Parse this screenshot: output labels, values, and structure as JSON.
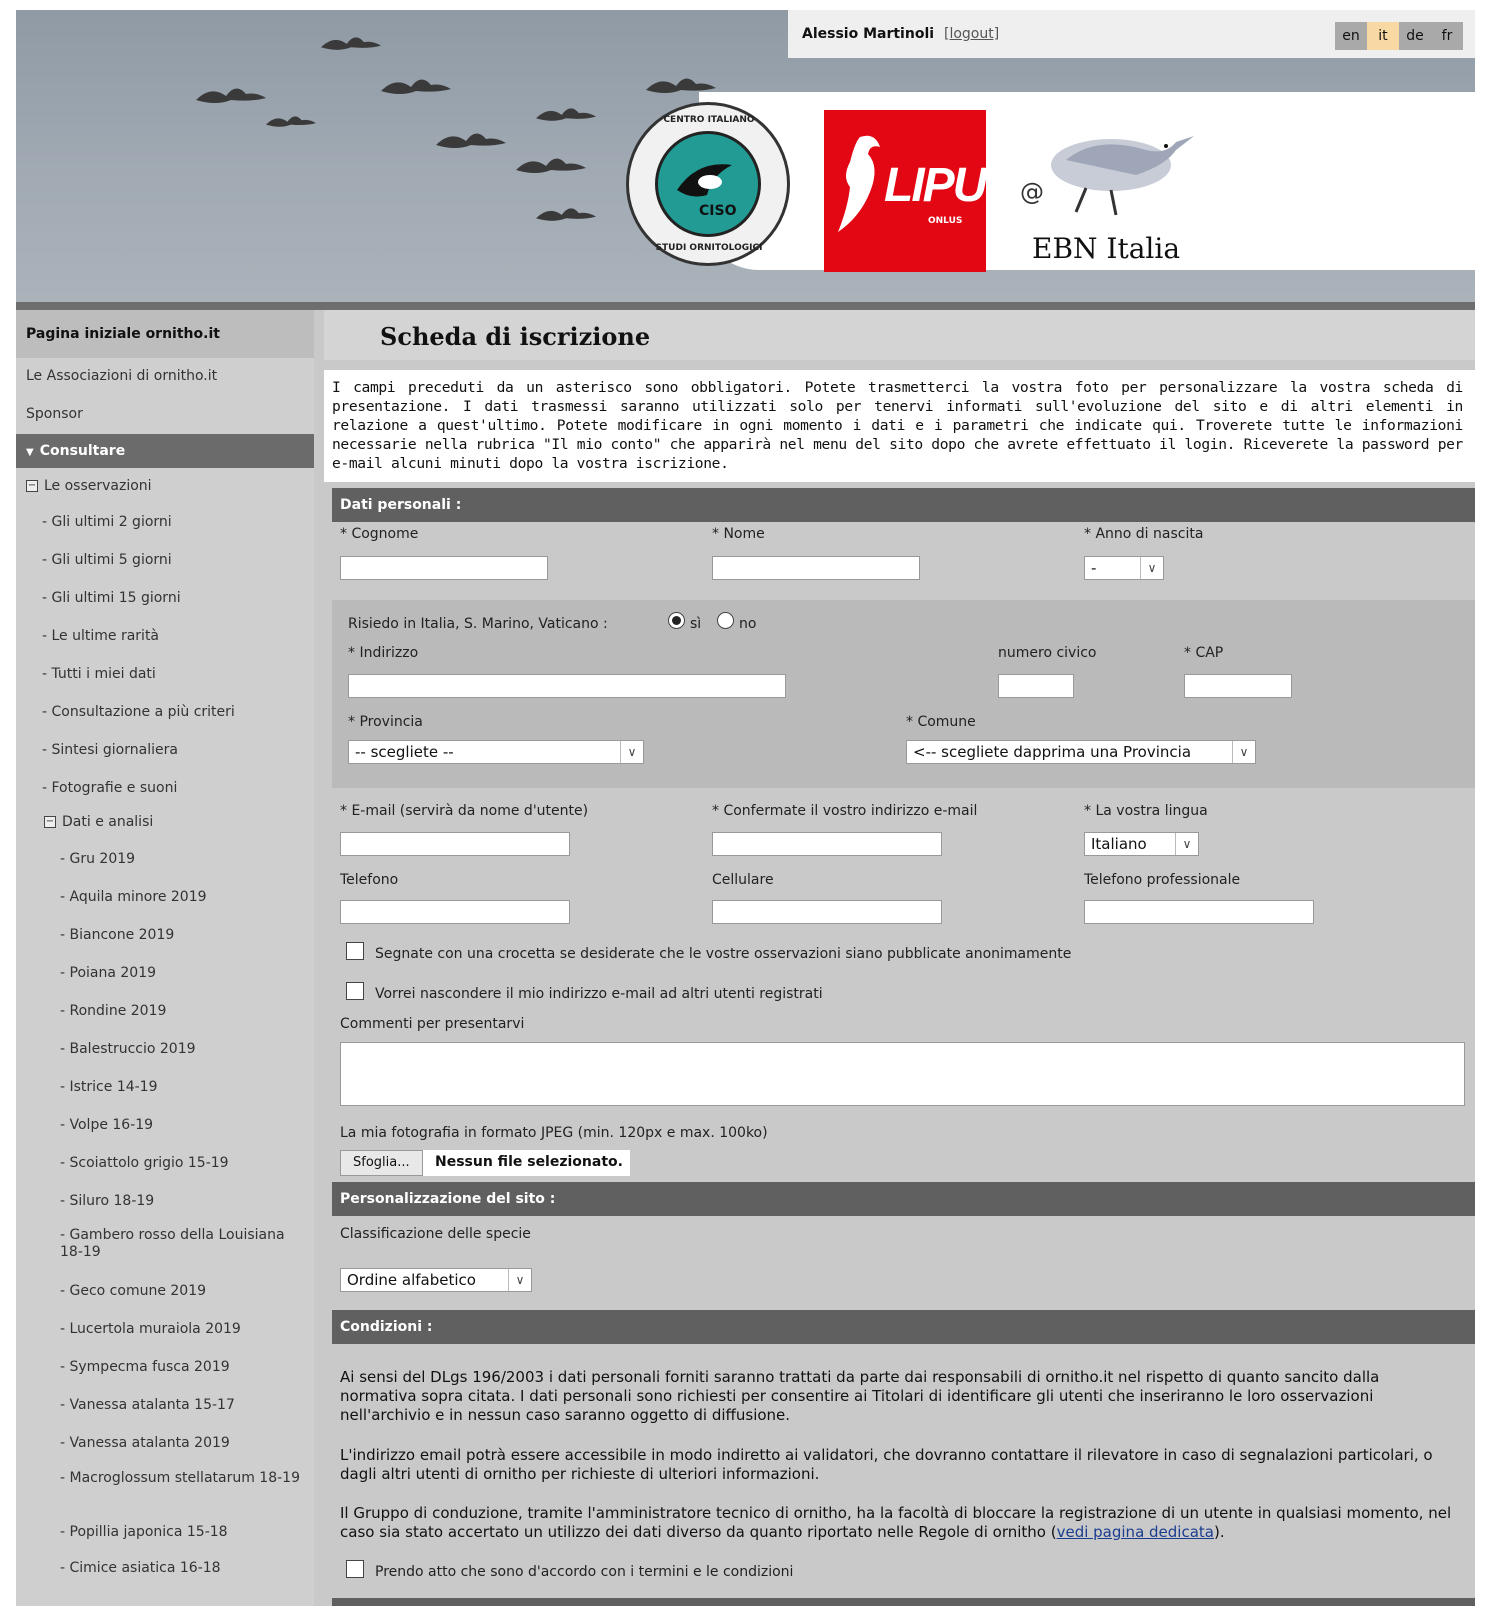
{
  "header": {
    "user_name": "Alessio Martinoli",
    "logout_label": "[logout]",
    "languages": [
      "en",
      "it",
      "de",
      "fr"
    ],
    "active_language": "it",
    "logos": {
      "ciso_ring_top": "CENTRO ITALIANO",
      "ciso_ring_bottom": "STUDI ORNITOLOGICI",
      "ciso_text": "CISO",
      "lipu_text": "LIPU",
      "lipu_sub": "ONLUS",
      "ebn_at": "@",
      "ebn_text": "EBN Italia"
    }
  },
  "sidebar": {
    "home": "Pagina iniziale ornitho.it",
    "associations": "Le Associazioni di ornitho.it",
    "sponsor": "Sponsor",
    "consult_head": "Consultare",
    "observations": "Le osservazioni",
    "obs_items": [
      "- Gli ultimi 2 giorni",
      "- Gli ultimi 5 giorni",
      "- Gli ultimi 15 giorni",
      "- Le ultime rarità",
      "- Tutti i miei dati",
      "- Consultazione a più criteri",
      "- Sintesi giornaliera",
      "- Fotografie e suoni"
    ],
    "analysis": "Dati e analisi",
    "analysis_items": [
      "- Gru 2019",
      "- Aquila minore 2019",
      "- Biancone 2019",
      "- Poiana 2019",
      "- Rondine 2019",
      "- Balestruccio 2019",
      "- Istrice 14-19",
      "- Volpe 16-19",
      "- Scoiattolo grigio 15-19",
      "- Siluro 18-19",
      "- Gambero rosso della Louisiana 18-19",
      "- Geco comune 2019",
      "- Lucertola muraiola 2019",
      "- Sympecma fusca 2019",
      "- Vanessa atalanta 15-17",
      "- Vanessa atalanta 2019",
      "- Macroglossum stellatarum 18-19",
      "- Popillia japonica 15-18",
      "- Cimice asiatica 16-18"
    ]
  },
  "page": {
    "title": "Scheda di iscrizione",
    "intro": "I campi preceduti da un asterisco sono obbligatori. Potete trasmetterci la vostra foto per personalizzare la vostra scheda di presentazione. I dati trasmessi saranno utilizzati solo per tenervi informati sull'evoluzione del sito e di altri elementi in relazione a quest'ultimo. Potete modificare in ogni momento i dati e i parametri che indicate qui. Troverete tutte le informazioni necessarie nella rubrica \"Il mio conto\" che apparirà nel menu del sito dopo che avrete effettuato il login. Riceverete la password per e-mail alcuni minuti dopo la vostra iscrizione."
  },
  "personal": {
    "section": "Dati personali :",
    "surname_label": "* Cognome",
    "name_label": "* Nome",
    "birth_label": "* Anno di nascita",
    "birth_value": "-",
    "reside_label": "Risiedo in Italia, S. Marino, Vaticano :",
    "reside_yes": "sì",
    "reside_no": "no",
    "address_label": "* Indirizzo",
    "civic_label": "numero civico",
    "cap_label": "* CAP",
    "province_label": "* Provincia",
    "province_value": "-- scegliete --",
    "comune_label": "* Comune",
    "comune_value": "<-- scegliete dapprima una Provincia",
    "email_label": "* E-mail (servirà da nome d'utente)",
    "email_confirm_label": "* Confermate il vostro indirizzo e-mail",
    "lang_label": "* La vostra lingua",
    "lang_value": "Italiano",
    "phone_label": "Telefono",
    "mobile_label": "Cellulare",
    "work_phone_label": "Telefono professionale",
    "anon_label": "Segnate con una crocetta se desiderate che le vostre osservazioni siano pubblicate anonimamente",
    "hide_email_label": "Vorrei nascondere il mio indirizzo e-mail ad altri utenti registrati",
    "comments_label": "Commenti per presentarvi",
    "photo_label": "La mia fotografia in formato JPEG (min. 120px e max. 100ko)",
    "browse_label": "Sfoglia...",
    "no_file": "Nessun file selezionato."
  },
  "custom": {
    "section": "Personalizzazione del sito :",
    "classification_label": "Classificazione delle specie",
    "classification_value": "Ordine alfabetico"
  },
  "conditions": {
    "section": "Condizioni :",
    "p1": "Ai sensi del DLgs 196/2003 i dati personali forniti saranno trattati da parte dai responsabili di ornitho.it nel rispetto di quanto sancito dalla normativa sopra citata. I dati personali sono richiesti per consentire ai Titolari di identificare gli utenti che inseriranno le loro osservazioni nell'archivio e in nessun caso saranno oggetto di diffusione.",
    "p2": "L'indirizzo email potrà essere accessibile in modo indiretto ai validatori, che dovranno contattare il rilevatore in caso di segnalazioni particolari, o dagli altri utenti di ornitho per richieste di ulteriori informazioni.",
    "p3": "Il Gruppo di conduzione, tramite l'amministratore tecnico di ornitho, ha la facoltà di bloccare la registrazione di un utente in qualsiasi momento, nel caso sia stato accertato un utilizzo dei dati diverso da quanto riportato nelle Regole di ornitho (",
    "p3_link": "vedi pagina dedicata",
    "p3_end": ").",
    "agree_label": "Prendo atto che sono d'accordo con i termini e le condizioni"
  }
}
